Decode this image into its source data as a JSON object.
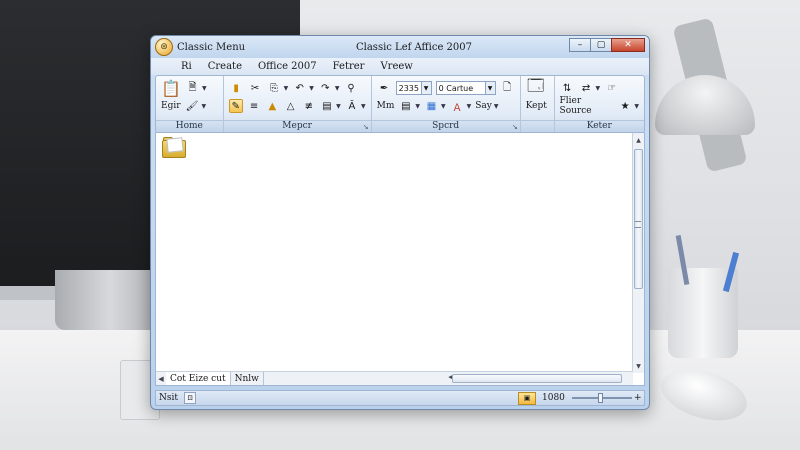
{
  "window": {
    "title_left": "Classic Menu",
    "title_center": "Classic Lef Affice 2007",
    "controls": {
      "minimize": "–",
      "maximize": "▢",
      "close": "✕"
    }
  },
  "menubar": {
    "items": [
      "Ri",
      "Create",
      "Office 2007",
      "Fetrer",
      "Vreew"
    ]
  },
  "ribbon": {
    "groups": {
      "home": {
        "label": "Home",
        "items": [
          "paste-icon",
          "clipboard-icon",
          "Egir",
          "format-painter-icon"
        ]
      },
      "mepor": {
        "label": "Mepcr",
        "launcher": "↘",
        "items": [
          "cut-icon",
          "copy-icon",
          "undo-icon",
          "find-icon",
          "highlight-icon",
          "align-left-icon",
          "font-color-icon",
          "spell-icon"
        ]
      },
      "spacing": {
        "label": "Spcrd",
        "launcher": "↘",
        "size_value": "2335",
        "font_value": "0 Cartue",
        "mm_label": "Mm",
        "say_label": "Say"
      },
      "kept": {
        "label": "",
        "kept_label": "Kept"
      },
      "keter": {
        "label": "Keter",
        "filter_label": "Flier Source"
      }
    }
  },
  "document": {
    "sheet_tab": "Cot Eize cut",
    "sheet_tab2": "Nnlw"
  },
  "statusbar": {
    "ready": "Nsit",
    "zoom": "1080",
    "plus": "+"
  },
  "colors": {
    "title_gradient_top": "#dbe8f7",
    "ribbon_top": "#f7fafd",
    "close_red": "#c7452c",
    "folder_yellow": "#f2d775"
  }
}
